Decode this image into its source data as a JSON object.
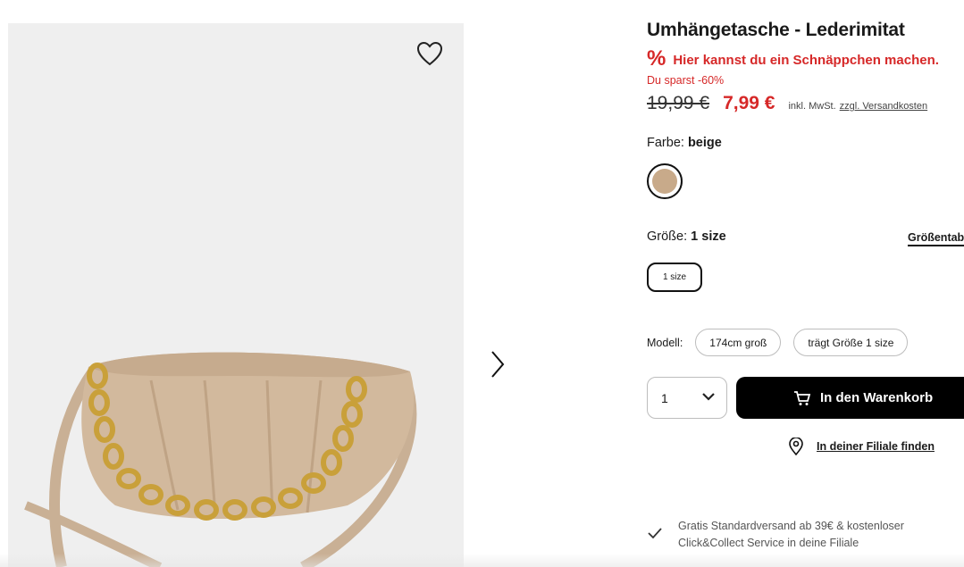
{
  "product": {
    "title": "Umhängetasche - Lederimitat",
    "deal_icon": "%",
    "deal_text": "Hier kannst du ein Schnäppchen machen.",
    "savings": "Du sparst -60%",
    "old_price": "19,99 €",
    "new_price": "7,99 €",
    "tax_note": "inkl. MwSt.",
    "shipping_link": "zzgl. Versandkosten"
  },
  "color": {
    "label": "Farbe:",
    "value": "beige",
    "swatch_hex": "#c8aa8a"
  },
  "size": {
    "label": "Größe:",
    "value": "1 size",
    "table_link": "Größentab",
    "option": "1 size"
  },
  "model": {
    "label": "Modell:",
    "chips": [
      "174cm groß",
      "trägt Größe 1 size"
    ]
  },
  "purchase": {
    "quantity": "1",
    "cart_label": "In den Warenkorb"
  },
  "store_finder": {
    "label": "In deiner Filiale finden"
  },
  "shipping_info": {
    "line1": "Gratis Standardversand ab 39€ & kostenloser",
    "line2": "Click&Collect Service in deine Filiale"
  },
  "icons": {
    "wishlist": "heart-icon",
    "next": "chevron-right-icon",
    "cart": "cart-icon",
    "location": "location-pin-icon",
    "check": "check-icon",
    "dropdown": "chevron-down-icon"
  },
  "colors": {
    "sale_red": "#d62828",
    "button_black": "#000000",
    "gallery_bg": "#efefef"
  }
}
